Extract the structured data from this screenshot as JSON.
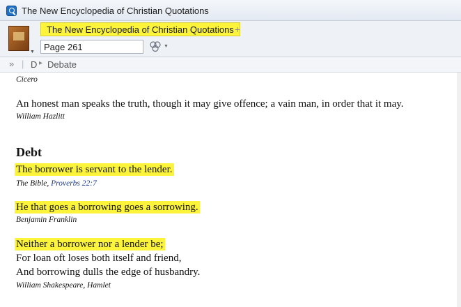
{
  "window": {
    "title": "The New Encyclopedia of Christian Quotations"
  },
  "tabs": [
    {
      "label": "The New Encyclopedia of Christian Quotations",
      "active": true
    }
  ],
  "tab_add_label": "+",
  "navigation": {
    "page_value": "Page 261"
  },
  "breadcrumb": {
    "expand": "»",
    "items": [
      "D",
      "Debate"
    ],
    "separator": "▸"
  },
  "content": {
    "prev_attribution": "Cicero",
    "prev_quote": {
      "text": "An honest man speaks the truth, though it may give offence; a vain man, in order that it may.",
      "attribution": "William Hazlitt"
    },
    "section_heading": "Debt",
    "quotes": [
      {
        "lines": [
          "The borrower is servant to the lender."
        ],
        "highlighted_lines": 1,
        "attribution_prefix": "The Bible, ",
        "attribution_link": "Proverbs 22:7"
      },
      {
        "lines": [
          "He that goes a borrowing goes a sorrowing."
        ],
        "highlighted_lines": 1,
        "attribution": "Benjamin Franklin"
      },
      {
        "lines": [
          "Neither a borrower nor a lender be;",
          "For loan oft loses both itself and friend,",
          "And borrowing dulls the edge of husbandry."
        ],
        "highlighted_lines": 1,
        "attribution": "William Shakespeare, Hamlet"
      }
    ]
  },
  "colors": {
    "highlight": "#fbf43a",
    "link": "#1a3a8a"
  },
  "icons": {
    "app": "app-search-icon",
    "book": "book-cover-icon",
    "sync": "link-set-icon",
    "expand": "expand-chevrons-icon"
  }
}
